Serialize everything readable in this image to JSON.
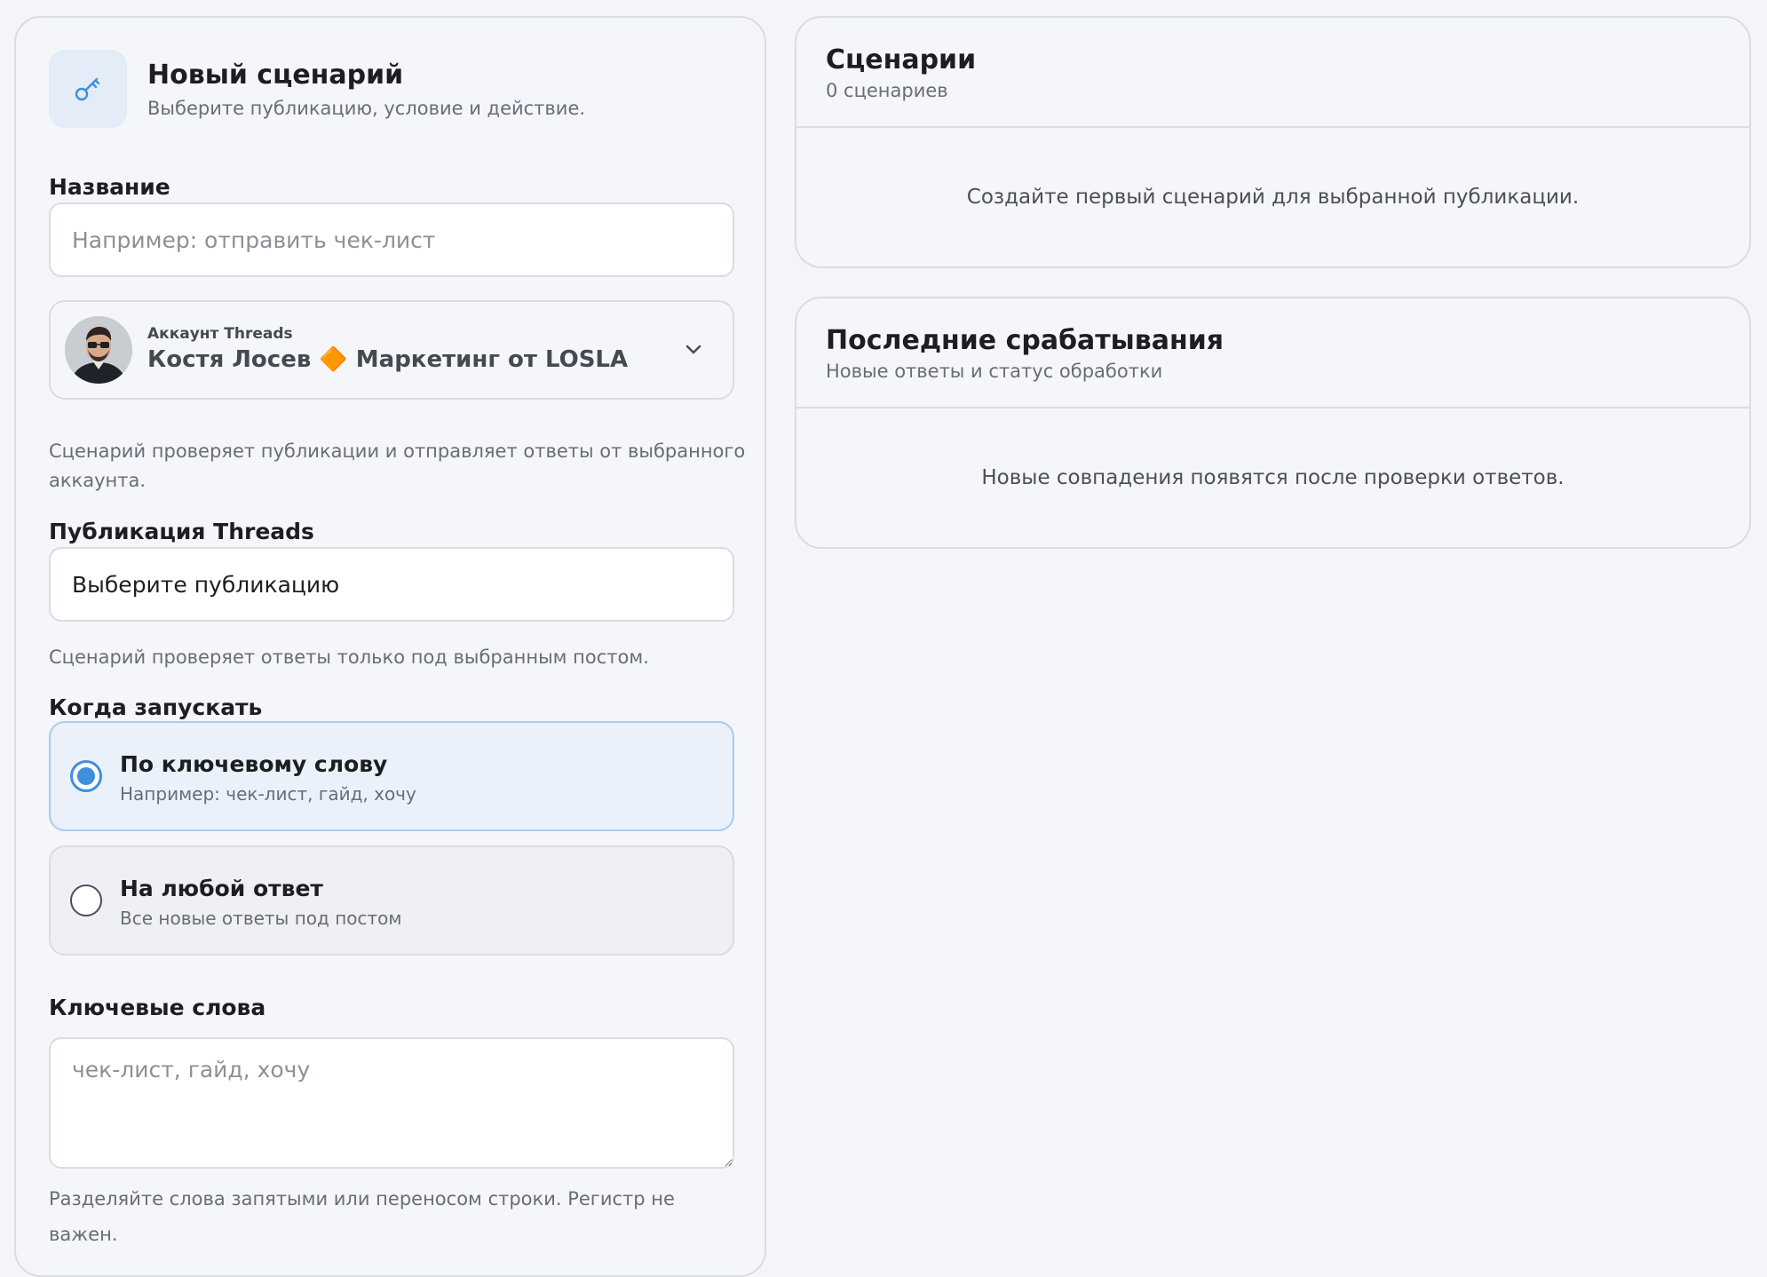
{
  "colors": {
    "accent": "#3f8fdc",
    "page_background": "#f4f5f8",
    "card_border": "#d9dce3",
    "selected_option_background": "#eaf1fa"
  },
  "form": {
    "icon": "key-icon",
    "title": "Новый сценарий",
    "subtitle": "Выберите публикацию, условие и действие.",
    "name_label": "Название",
    "name_placeholder": "Например: отправить чек-лист",
    "account": {
      "caption": "Аккаунт Threads",
      "name": "Костя Лосев 🔶 Маркетинг от LOSLA",
      "avatar_icon": "avatar-photo",
      "chevron_icon": "chevron-down-icon"
    },
    "account_hint": "Сценарий проверяет публикации и отправляет ответы от выбранного аккаунта.",
    "publication_label": "Публикация Threads",
    "publication_value": "Выберите публикацию",
    "publication_hint": "Сценарий проверяет ответы только под выбранным постом.",
    "trigger_label": "Когда запускать",
    "trigger_options": [
      {
        "title": "По ключевому слову",
        "description": "Например: чек-лист, гайд, хочу",
        "selected": true
      },
      {
        "title": "На любой ответ",
        "description": "Все новые ответы под постом",
        "selected": false
      }
    ],
    "keywords_label": "Ключевые слова",
    "keywords_placeholder": "чек-лист, гайд, хочу",
    "keywords_hint": "Разделяйте слова запятыми или переносом строки. Регистр не важен."
  },
  "scenarios_panel": {
    "title": "Сценарии",
    "count": "0 сценариев",
    "empty_text": "Создайте первый сценарий для выбранной публикации."
  },
  "triggers_panel": {
    "title": "Последние срабатывания",
    "subtitle": "Новые ответы и статус обработки",
    "empty_text": "Новые совпадения появятся после проверки ответов."
  }
}
